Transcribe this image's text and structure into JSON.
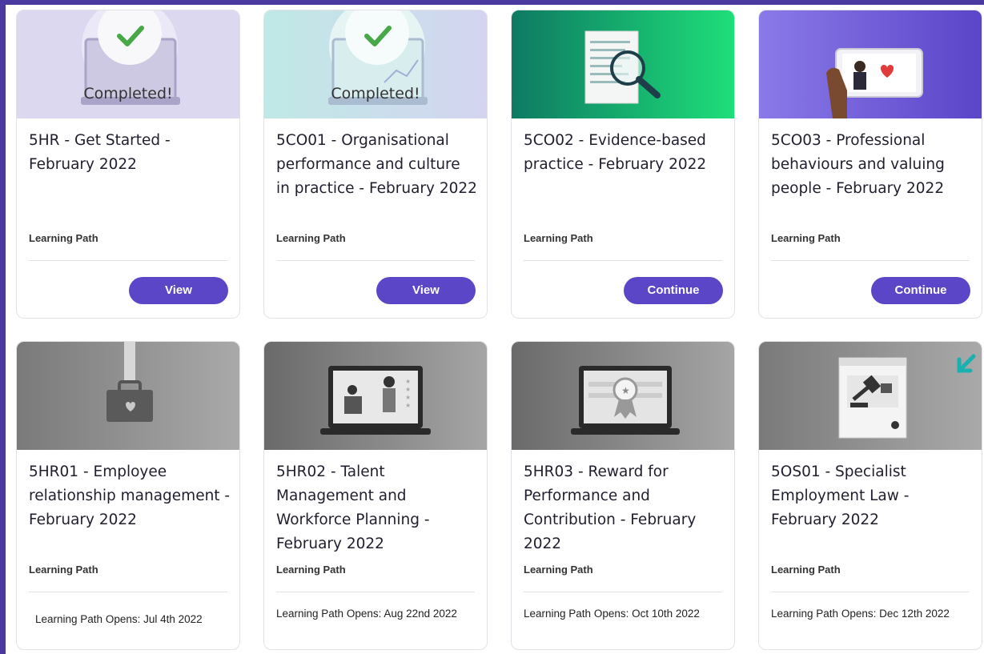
{
  "cards": [
    {
      "title": "5HR - Get Started - February 2022",
      "type": "Learning Path",
      "badge": "Completed!",
      "action": "View",
      "icon": "laptop-check-icon"
    },
    {
      "title": "5CO01 - Organisational performance and culture in practice - February 2022",
      "type": "Learning Path",
      "badge": "Completed!",
      "action": "View",
      "icon": "laptop-chart-check-icon"
    },
    {
      "title": "5CO02 - Evidence-based practice - February 2022",
      "type": "Learning Path",
      "action": "Continue",
      "icon": "document-magnifier-icon"
    },
    {
      "title": "5CO03 - Professional behaviours and valuing people - February 2022",
      "type": "Learning Path",
      "action": "Continue",
      "icon": "tablet-care-icon"
    },
    {
      "title": "5HR01 - Employee relationship management - February 2022",
      "type": "Learning Path",
      "opens": "Learning Path Opens: Jul 4th 2022",
      "icon": "briefcase-heart-icon"
    },
    {
      "title": "5HR02 - Talent Management and Workforce Planning - February 2022",
      "type": "Learning Path",
      "opens": "Learning Path Opens: Aug 22nd 2022",
      "icon": "laptop-people-rating-icon"
    },
    {
      "title": "5HR03 - Reward for Performance and Contribution - February 2022",
      "type": "Learning Path",
      "opens": "Learning Path Opens: Oct 10th 2022",
      "icon": "laptop-award-icon"
    },
    {
      "title": "5OS01 - Specialist Employment Law - February 2022",
      "type": "Learning Path",
      "opens": "Learning Path Opens: Dec 12th 2022",
      "icon": "gavel-document-icon"
    }
  ],
  "colors": {
    "accent": "#5a46c6",
    "frame": "#4a3aa0",
    "green": "#20c070",
    "check": "#48a848",
    "teal": "#1ab0b0"
  }
}
